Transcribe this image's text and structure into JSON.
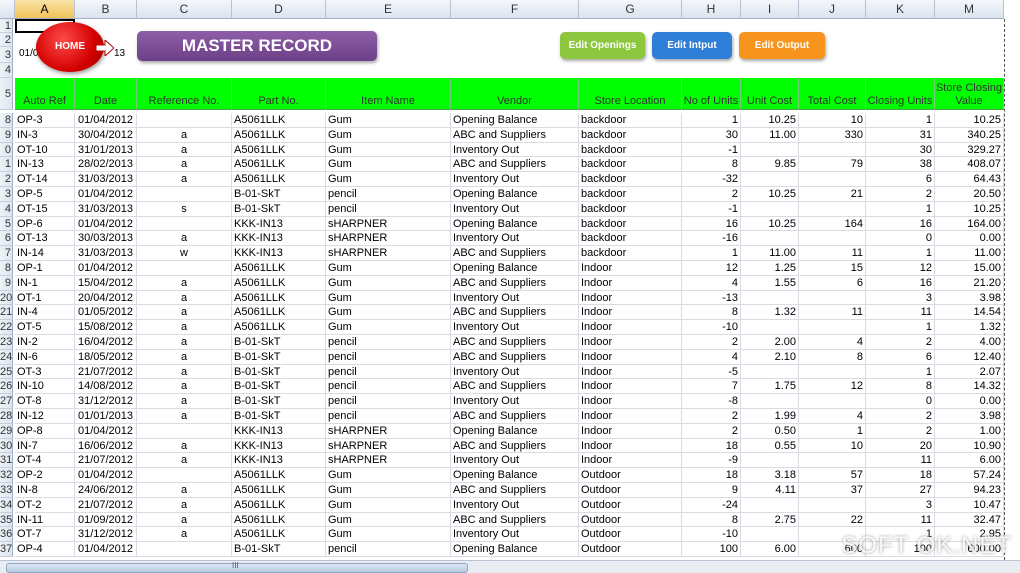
{
  "columns": [
    "A",
    "B",
    "C",
    "D",
    "E",
    "F",
    "G",
    "H",
    "I",
    "J",
    "K",
    "M"
  ],
  "buttons": {
    "home": "HOME",
    "edit_openings": "Edit Openings",
    "edit_input": "Edit Intput",
    "edit_output": "Edit Output",
    "edit_openings_color": "#8dc63f",
    "edit_input_color": "#2f7ed8",
    "edit_output_color": "#f7941d"
  },
  "title": "MASTER RECORD",
  "row3_text": "01/0",
  "row3_text2": "13",
  "top_row_numbers": [
    "1",
    "2",
    "3",
    "4",
    "5"
  ],
  "headers": [
    "Auto Ref",
    "Date",
    "Reference No.",
    "Part No.",
    "Item Name",
    "Vendor",
    "Store Location",
    "No of Units",
    "Unit Cost",
    "Total Cost",
    "Closing Units",
    "Store Closing Value"
  ],
  "header_color": "#00ff00",
  "rows": [
    {
      "n": "8",
      "c": [
        "OP-3",
        "01/04/2012",
        "",
        "A5061LLK",
        "Gum",
        "Opening Balance",
        "backdoor",
        "1",
        "10.25",
        "10",
        "1",
        "10.25"
      ]
    },
    {
      "n": "9",
      "c": [
        "IN-3",
        "30/04/2012",
        "a",
        "A5061LLK",
        "Gum",
        "ABC and Suppliers",
        "backdoor",
        "30",
        "11.00",
        "330",
        "31",
        "340.25"
      ]
    },
    {
      "n": "0",
      "c": [
        "OT-10",
        "31/01/2013",
        "a",
        "A5061LLK",
        "Gum",
        "Inventory Out",
        "backdoor",
        "-1",
        "",
        "",
        "30",
        "329.27"
      ]
    },
    {
      "n": "1",
      "c": [
        "IN-13",
        "28/02/2013",
        "a",
        "A5061LLK",
        "Gum",
        "ABC and Suppliers",
        "backdoor",
        "8",
        "9.85",
        "79",
        "38",
        "408.07"
      ]
    },
    {
      "n": "2",
      "c": [
        "OT-14",
        "31/03/2013",
        "a",
        "A5061LLK",
        "Gum",
        "Inventory Out",
        "backdoor",
        "-32",
        "",
        "",
        "6",
        "64.43"
      ]
    },
    {
      "n": "3",
      "c": [
        "OP-5",
        "01/04/2012",
        "",
        "B-01-SkT",
        "pencil",
        "Opening Balance",
        "backdoor",
        "2",
        "10.25",
        "21",
        "2",
        "20.50"
      ]
    },
    {
      "n": "4",
      "c": [
        "OT-15",
        "31/03/2013",
        "s",
        "B-01-SkT",
        "pencil",
        "Inventory Out",
        "backdoor",
        "-1",
        "",
        "",
        "1",
        "10.25"
      ]
    },
    {
      "n": "5",
      "c": [
        "OP-6",
        "01/04/2012",
        "",
        "KKK-IN13",
        "sHARPNER",
        "Opening Balance",
        "backdoor",
        "16",
        "10.25",
        "164",
        "16",
        "164.00"
      ]
    },
    {
      "n": "6",
      "c": [
        "OT-13",
        "30/03/2013",
        "a",
        "KKK-IN13",
        "sHARPNER",
        "Inventory Out",
        "backdoor",
        "-16",
        "",
        "",
        "0",
        "0.00"
      ]
    },
    {
      "n": "7",
      "c": [
        "IN-14",
        "31/03/2013",
        "w",
        "KKK-IN13",
        "sHARPNER",
        "ABC and Suppliers",
        "backdoor",
        "1",
        "11.00",
        "11",
        "1",
        "11.00"
      ]
    },
    {
      "n": "8",
      "c": [
        "OP-1",
        "01/04/2012",
        "",
        "A5061LLK",
        "Gum",
        "Opening Balance",
        "Indoor",
        "12",
        "1.25",
        "15",
        "12",
        "15.00"
      ]
    },
    {
      "n": "9",
      "c": [
        "IN-1",
        "15/04/2012",
        "a",
        "A5061LLK",
        "Gum",
        "ABC and Suppliers",
        "Indoor",
        "4",
        "1.55",
        "6",
        "16",
        "21.20"
      ]
    },
    {
      "n": "20",
      "c": [
        "OT-1",
        "20/04/2012",
        "a",
        "A5061LLK",
        "Gum",
        "Inventory Out",
        "Indoor",
        "-13",
        "",
        "",
        "3",
        "3.98"
      ]
    },
    {
      "n": "21",
      "c": [
        "IN-4",
        "01/05/2012",
        "a",
        "A5061LLK",
        "Gum",
        "ABC and Suppliers",
        "Indoor",
        "8",
        "1.32",
        "11",
        "11",
        "14.54"
      ]
    },
    {
      "n": "22",
      "c": [
        "OT-5",
        "15/08/2012",
        "a",
        "A5061LLK",
        "Gum",
        "Inventory Out",
        "Indoor",
        "-10",
        "",
        "",
        "1",
        "1.32"
      ]
    },
    {
      "n": "23",
      "c": [
        "IN-2",
        "16/04/2012",
        "a",
        "B-01-SkT",
        "pencil",
        "ABC and Suppliers",
        "Indoor",
        "2",
        "2.00",
        "4",
        "2",
        "4.00"
      ]
    },
    {
      "n": "24",
      "c": [
        "IN-6",
        "18/05/2012",
        "a",
        "B-01-SkT",
        "pencil",
        "ABC and Suppliers",
        "Indoor",
        "4",
        "2.10",
        "8",
        "6",
        "12.40"
      ]
    },
    {
      "n": "25",
      "c": [
        "OT-3",
        "21/07/2012",
        "a",
        "B-01-SkT",
        "pencil",
        "Inventory Out",
        "Indoor",
        "-5",
        "",
        "",
        "1",
        "2.07"
      ]
    },
    {
      "n": "26",
      "c": [
        "IN-10",
        "14/08/2012",
        "a",
        "B-01-SkT",
        "pencil",
        "ABC and Suppliers",
        "Indoor",
        "7",
        "1.75",
        "12",
        "8",
        "14.32"
      ]
    },
    {
      "n": "27",
      "c": [
        "OT-8",
        "31/12/2012",
        "a",
        "B-01-SkT",
        "pencil",
        "Inventory Out",
        "Indoor",
        "-8",
        "",
        "",
        "0",
        "0.00"
      ]
    },
    {
      "n": "28",
      "c": [
        "IN-12",
        "01/01/2013",
        "a",
        "B-01-SkT",
        "pencil",
        "ABC and Suppliers",
        "Indoor",
        "2",
        "1.99",
        "4",
        "2",
        "3.98"
      ]
    },
    {
      "n": "29",
      "c": [
        "OP-8",
        "01/04/2012",
        "",
        "KKK-IN13",
        "sHARPNER",
        "Opening Balance",
        "Indoor",
        "2",
        "0.50",
        "1",
        "2",
        "1.00"
      ]
    },
    {
      "n": "30",
      "c": [
        "IN-7",
        "16/06/2012",
        "a",
        "KKK-IN13",
        "sHARPNER",
        "ABC and Suppliers",
        "Indoor",
        "18",
        "0.55",
        "10",
        "20",
        "10.90"
      ]
    },
    {
      "n": "31",
      "c": [
        "OT-4",
        "21/07/2012",
        "a",
        "KKK-IN13",
        "sHARPNER",
        "Inventory Out",
        "Indoor",
        "-9",
        "",
        "",
        "11",
        "6.00"
      ]
    },
    {
      "n": "32",
      "c": [
        "OP-2",
        "01/04/2012",
        "",
        "A5061LLK",
        "Gum",
        "Opening Balance",
        "Outdoor",
        "18",
        "3.18",
        "57",
        "18",
        "57.24"
      ]
    },
    {
      "n": "33",
      "c": [
        "IN-8",
        "24/06/2012",
        "a",
        "A5061LLK",
        "Gum",
        "ABC and Suppliers",
        "Outdoor",
        "9",
        "4.11",
        "37",
        "27",
        "94.23"
      ]
    },
    {
      "n": "34",
      "c": [
        "OT-2",
        "21/07/2012",
        "a",
        "A5061LLK",
        "Gum",
        "Inventory Out",
        "Outdoor",
        "-24",
        "",
        "",
        "3",
        "10.47"
      ]
    },
    {
      "n": "35",
      "c": [
        "IN-11",
        "01/09/2012",
        "a",
        "A5061LLK",
        "Gum",
        "ABC and Suppliers",
        "Outdoor",
        "8",
        "2.75",
        "22",
        "11",
        "32.47"
      ]
    },
    {
      "n": "36",
      "c": [
        "OT-7",
        "31/12/2012",
        "a",
        "A5061LLK",
        "Gum",
        "Inventory Out",
        "Outdoor",
        "-10",
        "",
        "",
        "1",
        "2.95"
      ]
    },
    {
      "n": "37",
      "c": [
        "OP-4",
        "01/04/2012",
        "",
        "B-01-SkT",
        "pencil",
        "Opening Balance",
        "Outdoor",
        "100",
        "6.00",
        "600",
        "100",
        "600.00"
      ]
    }
  ],
  "watermark": "SOFT OK.NET",
  "scroll_grip": "III"
}
